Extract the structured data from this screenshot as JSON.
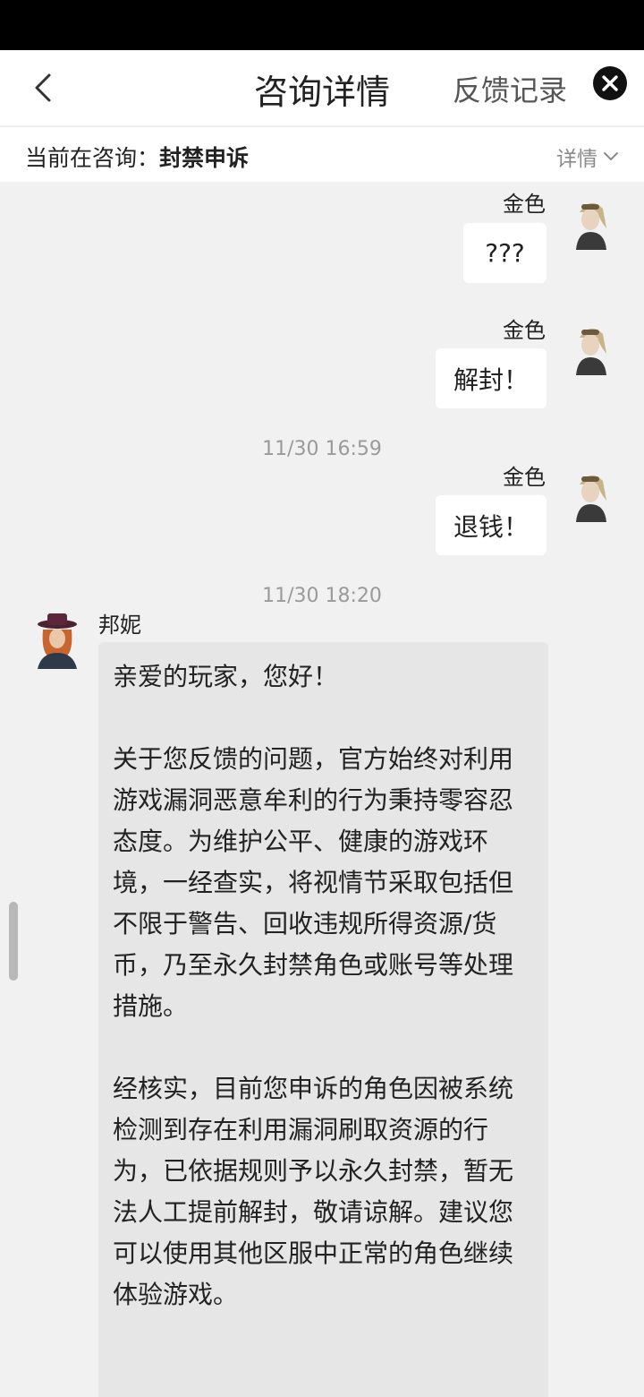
{
  "nav": {
    "title": "咨询详情",
    "feedback_label": "反馈记录",
    "back_icon": "chevron-left-icon",
    "close_icon": "close-icon"
  },
  "consult": {
    "label": "当前在咨询：",
    "topic": "封禁申诉",
    "detail_label": "详情"
  },
  "messages": [
    {
      "sender": "金色",
      "text": "???"
    },
    {
      "sender": "金色",
      "text": "解封！"
    },
    {
      "timestamp": "11/30 16:59",
      "sender": "金色",
      "text": "退钱！"
    }
  ],
  "reply": {
    "timestamp": "11/30 18:20",
    "sender": "邦妮",
    "paragraphs": [
      "亲爱的玩家，您好！",
      "关于您反馈的问题，官方始终对利用游戏漏洞恶意牟利的行为秉持零容忍态度。为维护公平、健康的游戏环境，一经查实，将视情节采取包括但不限于警告、回收违规所得资源/货币，乃至永久封禁角色或账号等处理措施。",
      "经核实，目前您申诉的角色因被系统检测到存在利用漏洞刷取资源的行为，已依据规则予以永久封禁，暂无法人工提前解封，敬请谅解。建议您可以使用其他区服中正常的角色继续体验游戏。"
    ]
  },
  "colors": {
    "nav_bg": "#ffffff",
    "chat_bg": "#f1f1f1",
    "user_bubble": "#ffffff",
    "agent_bubble": "#e6e6e6",
    "status_bar": "#000000"
  }
}
